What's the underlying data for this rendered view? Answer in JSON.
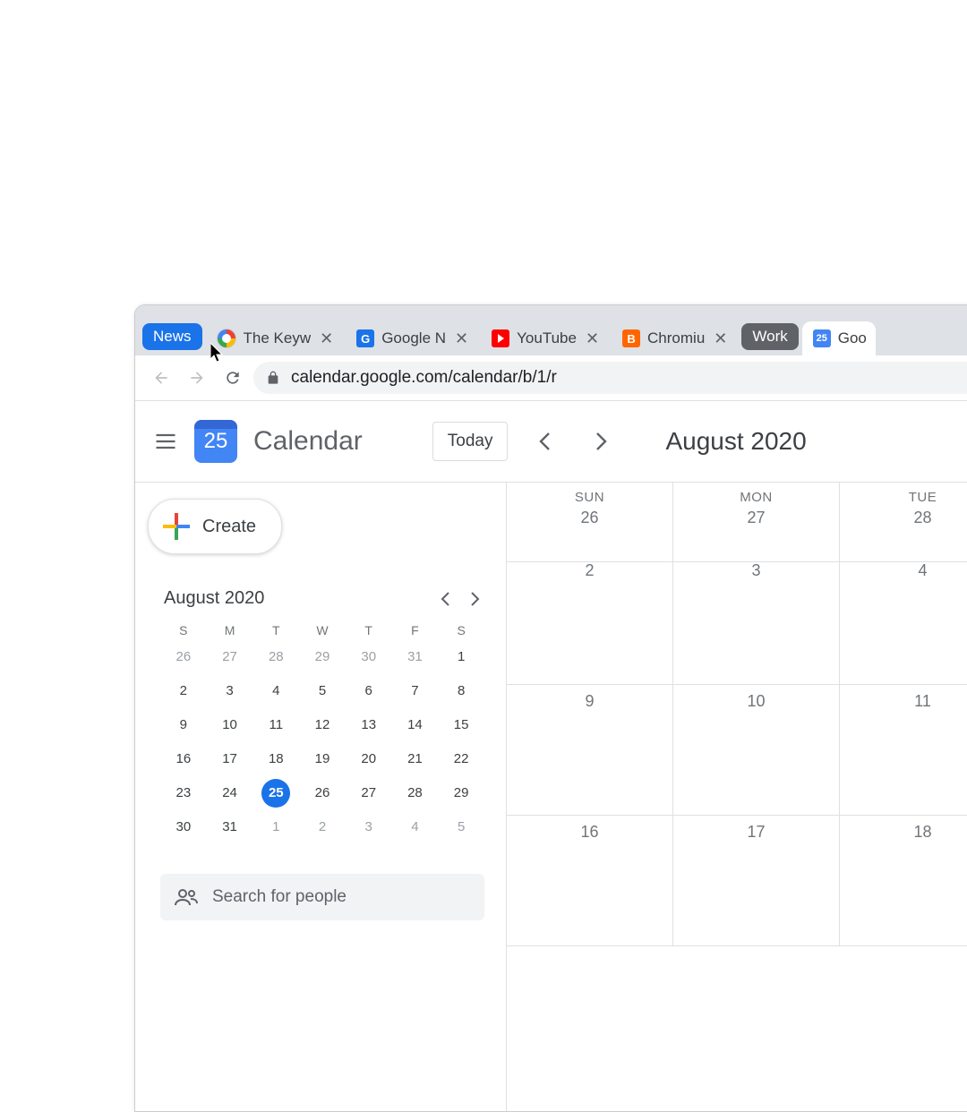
{
  "tabbar": {
    "group1_label": "News",
    "group2_label": "Work",
    "tabs": [
      {
        "favicon": "g",
        "title": "The Keyw"
      },
      {
        "favicon": "gnews",
        "title": "Google N"
      },
      {
        "favicon": "yt",
        "title": "YouTube"
      },
      {
        "favicon": "blogger",
        "title": "Chromiu"
      }
    ],
    "active_tab": {
      "favicon": "cal",
      "title": "Goo"
    }
  },
  "addressbar": {
    "url": "calendar.google.com/calendar/b/1/r"
  },
  "app": {
    "logo_day": "25",
    "title": "Calendar",
    "today_label": "Today",
    "month_title": "August 2020"
  },
  "create_label": "Create",
  "mini_cal": {
    "title": "August 2020",
    "dow": [
      "S",
      "M",
      "T",
      "W",
      "T",
      "F",
      "S"
    ],
    "weeks": [
      [
        {
          "d": "26",
          "dim": true
        },
        {
          "d": "27",
          "dim": true
        },
        {
          "d": "28",
          "dim": true
        },
        {
          "d": "29",
          "dim": true
        },
        {
          "d": "30",
          "dim": true
        },
        {
          "d": "31",
          "dim": true
        },
        {
          "d": "1"
        }
      ],
      [
        {
          "d": "2"
        },
        {
          "d": "3"
        },
        {
          "d": "4"
        },
        {
          "d": "5"
        },
        {
          "d": "6"
        },
        {
          "d": "7"
        },
        {
          "d": "8"
        }
      ],
      [
        {
          "d": "9"
        },
        {
          "d": "10"
        },
        {
          "d": "11"
        },
        {
          "d": "12"
        },
        {
          "d": "13"
        },
        {
          "d": "14"
        },
        {
          "d": "15"
        }
      ],
      [
        {
          "d": "16"
        },
        {
          "d": "17"
        },
        {
          "d": "18"
        },
        {
          "d": "19"
        },
        {
          "d": "20"
        },
        {
          "d": "21"
        },
        {
          "d": "22"
        }
      ],
      [
        {
          "d": "23"
        },
        {
          "d": "24"
        },
        {
          "d": "25",
          "today": true
        },
        {
          "d": "26"
        },
        {
          "d": "27"
        },
        {
          "d": "28"
        },
        {
          "d": "29"
        }
      ],
      [
        {
          "d": "30"
        },
        {
          "d": "31"
        },
        {
          "d": "1",
          "dim": true
        },
        {
          "d": "2",
          "dim": true
        },
        {
          "d": "3",
          "dim": true
        },
        {
          "d": "4",
          "dim": true
        },
        {
          "d": "5",
          "dim": true
        }
      ]
    ]
  },
  "people_search_placeholder": "Search for people",
  "main_grid": {
    "dow": [
      "SUN",
      "MON",
      "TUE"
    ],
    "header_dates": [
      "26",
      "27",
      "28"
    ],
    "rows": [
      [
        "2",
        "3",
        "4"
      ],
      [
        "9",
        "10",
        "11"
      ],
      [
        "16",
        "17",
        "18"
      ]
    ]
  }
}
